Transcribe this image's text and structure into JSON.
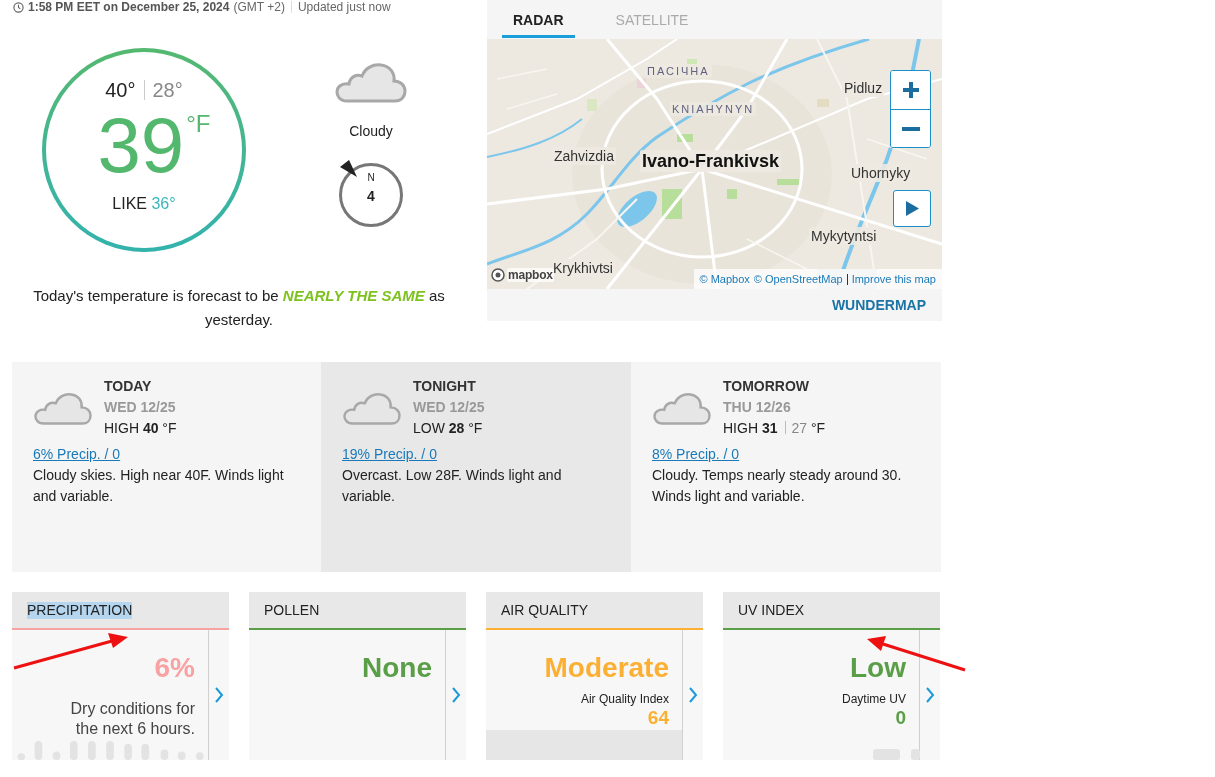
{
  "status": {
    "time": "1:58 PM EET on December 25, 2024",
    "timezone": "(GMT +2)",
    "updated": "Updated just now"
  },
  "current": {
    "high": "40°",
    "low": "28°",
    "temperature": "39",
    "unit": "°F",
    "feels_like_label": "LIKE",
    "feels_like": "36°",
    "condition": "Cloudy",
    "wind": {
      "direction": "N",
      "speed": "4"
    },
    "summary": "Today's temperature is forecast to be **NEARLY THE SAME** as yesterday."
  },
  "map": {
    "tabs": [
      {
        "label": "RADAR",
        "selected": true
      },
      {
        "label": "SATELLITE",
        "selected": false
      }
    ],
    "place_labels": [
      {
        "text": "ПАСІЧНА",
        "kind": "district"
      },
      {
        "text": "KNIAHYNYN",
        "kind": "district"
      },
      {
        "text": "Pidluz",
        "kind": "village"
      },
      {
        "text": "Zahvizdia",
        "kind": "village"
      },
      {
        "text": "Ivano-Frankivsk",
        "kind": "city"
      },
      {
        "text": "Uhornyky",
        "kind": "village"
      },
      {
        "text": "Mykytyntsi",
        "kind": "village"
      },
      {
        "text": "Krykhivtsi",
        "kind": "village"
      }
    ],
    "logo": "mapbox",
    "attribution": [
      "© Mapbox",
      "© OpenStreetMap",
      "Improve this map"
    ],
    "link": "WUNDERMAP"
  },
  "forecast": [
    {
      "title": "TODAY",
      "date": "WED 12/25",
      "temp": {
        "label": "HIGH",
        "value": "40",
        "unit": "°F"
      },
      "precip": "6% Precip. / 0",
      "description": "Cloudy skies. High near 40F. Winds light and variable.",
      "selected": false
    },
    {
      "title": "TONIGHT",
      "date": "WED 12/25",
      "temp": {
        "label": "LOW",
        "value": "28",
        "unit": "°F"
      },
      "precip": "19% Precip. / 0",
      "description": "Overcast. Low 28F. Winds light and variable.",
      "selected": true
    },
    {
      "title": "TOMORROW",
      "date": "THU 12/26",
      "temp": {
        "label": "HIGH",
        "value": "31",
        "secondary": "27",
        "unit": "°F"
      },
      "precip": "8% Precip. / 0",
      "description": "Cloudy. Temps nearly steady around 30. Winds light and variable.",
      "selected": false
    }
  ],
  "metrics": [
    {
      "kind": "precipitation",
      "title": "PRECIPITATION",
      "title_highlighted": true,
      "color": "#f7a3a3",
      "value": "6%",
      "note": "Dry conditions for the next 6 hours."
    },
    {
      "kind": "pollen",
      "title": "POLLEN",
      "title_highlighted": false,
      "color": "#5a9e47",
      "value": "None"
    },
    {
      "kind": "air_quality",
      "title": "AIR QUALITY",
      "title_highlighted": false,
      "color": "#fbb034",
      "value": "Moderate",
      "index_label": "Air Quality Index",
      "index_value": "64"
    },
    {
      "kind": "uv",
      "title": "UV INDEX",
      "title_highlighted": false,
      "color": "#5a9e47",
      "value": "Low",
      "index_label": "Daytime UV",
      "index_value": "0"
    }
  ]
}
